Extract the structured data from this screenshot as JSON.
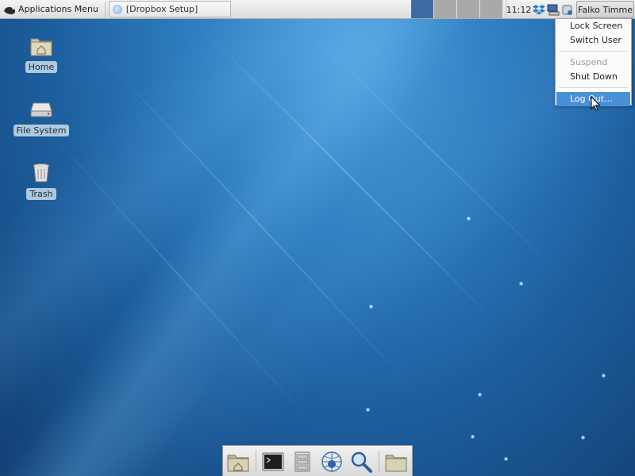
{
  "top_panel": {
    "applications_menu_label": "Applications Menu",
    "task_button_label": "[Dropbox Setup]",
    "workspaces": [
      {
        "active": true
      },
      {
        "active": false
      },
      {
        "active": false
      },
      {
        "active": false
      }
    ],
    "clock": "11:12",
    "user_button_label": "Falko Timme",
    "tray_icons": [
      "dropbox-icon",
      "network-icon",
      "power-icon"
    ]
  },
  "desktop_icons": [
    {
      "label": "Home",
      "icon": "home-folder-icon"
    },
    {
      "label": "File System",
      "icon": "drive-icon"
    },
    {
      "label": "Trash",
      "icon": "trash-icon"
    }
  ],
  "user_menu": {
    "items": [
      {
        "label": "Lock Screen",
        "state": "normal"
      },
      {
        "label": "Switch User",
        "state": "normal"
      },
      {
        "label": "Suspend",
        "state": "disabled"
      },
      {
        "label": "Shut Down",
        "state": "normal"
      },
      {
        "label": "Log Out...",
        "state": "hover"
      }
    ]
  },
  "dock": {
    "items": [
      "home-folder-icon",
      "terminal-icon",
      "file-manager-icon",
      "web-browser-icon",
      "search-icon",
      "folder-icon"
    ]
  },
  "colors": {
    "desktop_dark": "#123f74",
    "desktop_light": "#4fa3e0",
    "menu_highlight": "#4a90d9",
    "active_workspace": "#3e6aa6"
  }
}
